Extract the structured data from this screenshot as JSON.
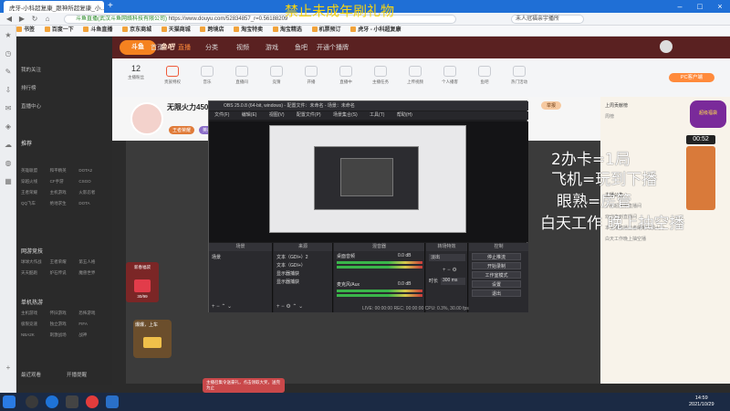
{
  "browser": {
    "tab_title": "虎牙-小科超复康_跟神所超复康_小...",
    "new_tab": "+",
    "url_secure": "斗鱼直播(武汉斗鱼网络科技有限公司)",
    "url": "https://www.douyu.com/52834857_r=0.56188209",
    "search_text": "未人冠福亲宇播所",
    "bookmarks": [
      "书签",
      "百度一下",
      "斗鱼直播",
      "京东商城",
      "天猫商城",
      "跨境店",
      "淘宝特卖",
      "淘宝精选",
      "机票预订",
      "虎牙 - 小科超复康"
    ]
  },
  "watermark": "禁止未成年刷礼物",
  "douyu": {
    "logo": "斗鱼",
    "logo2": "鱼吧",
    "nav": [
      "首页",
      "直播",
      "分类",
      "视频",
      "游戏",
      "鱼吧",
      "开通个播牌"
    ],
    "nav_active": "直播",
    "toolbar_count": "12",
    "toolbar": [
      "主播粉丝",
      "贵族特权",
      "音乐",
      "直播间",
      "竞猜",
      "开播",
      "直播中",
      "主播任务",
      "上传视频",
      "个人播客",
      "鱼吧",
      "热门活动"
    ],
    "pc_button": "PC客户端",
    "room_title": "无限火力450",
    "room_tag1": "王者荣耀",
    "room_tag2": "英雄联盟",
    "report": "举报",
    "sidebar": {
      "items": [
        "我的关注",
        "排行榜",
        "直播中心"
      ],
      "section1": "推荐",
      "grid1": [
        "英雄联盟",
        "和平精英",
        "DOTA2",
        "穿越火线",
        "CF手游",
        "CSGO",
        "王者荣耀",
        "主机游戏",
        "火影忍者",
        "QQ飞车",
        "绝地求生",
        "DOTA"
      ],
      "section2": "网游竞技",
      "grid2": [
        "球球大作战",
        "王者荣耀",
        "第五人格",
        "天天酷跑",
        "炉石传说",
        "魔兽世界"
      ],
      "section3": "单机热游",
      "grid3": [
        "主机游戏",
        "怀旧游戏",
        "恐怖游戏",
        "极限竞速",
        "独立游戏",
        "FIFA",
        "NBA2K",
        "刺激战场",
        "战神"
      ],
      "bottom": [
        "最近观看",
        "开播提醒"
      ]
    },
    "gift_box_label": "30/99",
    "gift_title": "新春福袋",
    "bonus_card": "爆爆，上车",
    "promo": "主播召集令送豪礼，点击领取大奖，送完为止",
    "right_panel": {
      "rows": [
        "上周贡献榜",
        "周榜",
        "主播公告",
        "小科超复康直播间",
        "欢迎来到直播间",
        "本主播直播王者荣耀无限火力",
        "白天工作晚上抽空播"
      ],
      "timer": "00:52",
      "side_widget": "超级福袋"
    }
  },
  "obs": {
    "title": "OBS 25.0.8 (64-bit, windows) - 配置文件：未命名 - 场景：未命名",
    "menu": [
      "文件(F)",
      "编辑(E)",
      "视图(V)",
      "配置文件(P)",
      "场景集合(S)",
      "工具(T)",
      "帮助(H)"
    ],
    "docks": [
      "场景",
      "来源",
      "混音器",
      "转场特效",
      "控制"
    ],
    "scene": "场景",
    "sources": [
      "文本（GDI+）2",
      "文本（GDI+）",
      "显示器捕获",
      "显示器捕获"
    ],
    "mixer": [
      {
        "name": "桌面音频",
        "db": "0.0 dB"
      },
      {
        "name": "麦克风/Aux",
        "db": "0.0 dB"
      }
    ],
    "transition": "淡出",
    "duration_label": "时长",
    "duration": "300 ms",
    "controls": [
      "停止推流",
      "开始录制",
      "工作室模式",
      "设置",
      "退出"
    ],
    "status": "LIVE: 00:00:00   REC: 00:00:00   CPU: 0.3%, 30.00 fps"
  },
  "overlay": {
    "line1": "2办卡=1局",
    "line2": "飞机=玩到下播",
    "line3": "眼熟=房管",
    "line4": "白天工作 晚上抽空播"
  },
  "taskbar": {
    "time": "14:59",
    "date": "2021/10/29"
  }
}
